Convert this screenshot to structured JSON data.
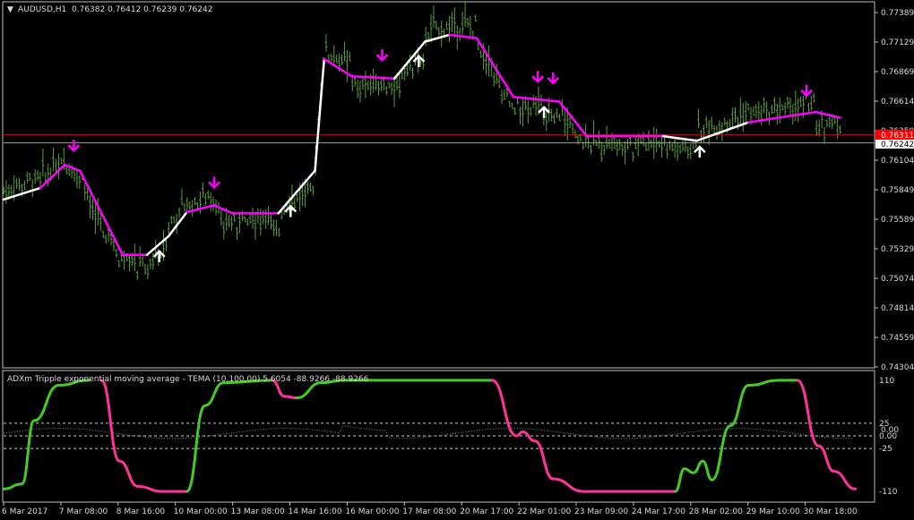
{
  "main_header": {
    "symbol": "AUDUSD,H1",
    "ohlc": "0.76382 0.76412 0.76239 0.76242"
  },
  "indicator_header": "ADXm Tripple exponential moving average - TEMA (10,100,00)  5.6054 -88.9266 -88.9266",
  "price_labels": [
    "0.77389",
    "0.77129",
    "0.76869",
    "0.76614",
    "0.76359",
    "0.76104",
    "0.75849",
    "0.75589",
    "0.75329",
    "0.75074",
    "0.74814",
    "0.74559",
    "0.74304"
  ],
  "current_price": "0.76242",
  "red_level_label": "0.76311",
  "indicator_labels": [
    "110",
    "25",
    "0.00",
    "-25",
    "-110"
  ],
  "indicator_extra_label": "0.00",
  "time_labels": [
    "6 Mar 2017",
    "7 Mar 08:00",
    "8 Mar 16:00",
    "10 Mar 00:00",
    "13 Mar 08:00",
    "14 Mar 16:00",
    "16 Mar 00:00",
    "17 Mar 08:00",
    "20 Mar 17:00",
    "22 Mar 01:00",
    "23 Mar 09:00",
    "24 Mar 17:00",
    "28 Mar 02:00",
    "29 Mar 10:00",
    "30 Mar 18:00"
  ],
  "colors": {
    "background": "#000000",
    "bars": "#5a9e3a",
    "trail_up": "#ffffff",
    "trail_down": "#ff00ff",
    "arrow_down": "#ff00ff",
    "arrow_up": "#ffffff",
    "ind_up": "#44cc22",
    "ind_down": "#ff3399",
    "red_level": "#ff0000",
    "current_line": "#a0a0a0"
  },
  "chart_data": {
    "type": "line",
    "price": {
      "ylim": [
        0.74304,
        0.77389
      ],
      "x": [
        "6 Mar 2017",
        "7 Mar 08:00",
        "8 Mar 16:00",
        "10 Mar 00:00",
        "13 Mar 08:00",
        "14 Mar 16:00",
        "16 Mar 00:00",
        "17 Mar 08:00",
        "20 Mar 17:00",
        "22 Mar 01:00",
        "23 Mar 09:00",
        "24 Mar 17:00",
        "28 Mar 02:00",
        "29 Mar 10:00",
        "30 Mar 18:00"
      ],
      "trail_points": [
        {
          "i": 0,
          "p": 0.7575,
          "trend": "up"
        },
        {
          "i": 0.6,
          "p": 0.7585,
          "trend": "up"
        },
        {
          "i": 1.0,
          "p": 0.7605,
          "trend": "down"
        },
        {
          "i": 1.25,
          "p": 0.76,
          "trend": "down"
        },
        {
          "i": 1.95,
          "p": 0.7527,
          "trend": "down"
        },
        {
          "i": 2.35,
          "p": 0.7527,
          "trend": "down"
        },
        {
          "i": 2.7,
          "p": 0.7543,
          "trend": "up"
        },
        {
          "i": 3.0,
          "p": 0.7564,
          "trend": "up"
        },
        {
          "i": 3.45,
          "p": 0.757,
          "trend": "down"
        },
        {
          "i": 3.75,
          "p": 0.7563,
          "trend": "down"
        },
        {
          "i": 4.5,
          "p": 0.7563,
          "trend": "down"
        },
        {
          "i": 5.1,
          "p": 0.76,
          "trend": "up"
        },
        {
          "i": 5.25,
          "p": 0.7697,
          "trend": "up"
        },
        {
          "i": 5.7,
          "p": 0.7682,
          "trend": "down"
        },
        {
          "i": 6.4,
          "p": 0.768,
          "trend": "down"
        },
        {
          "i": 6.9,
          "p": 0.7712,
          "trend": "up"
        },
        {
          "i": 7.3,
          "p": 0.7718,
          "trend": "up"
        },
        {
          "i": 7.75,
          "p": 0.7715,
          "trend": "down"
        },
        {
          "i": 8.35,
          "p": 0.7664,
          "trend": "down"
        },
        {
          "i": 9.1,
          "p": 0.766,
          "trend": "down"
        },
        {
          "i": 9.55,
          "p": 0.763,
          "trend": "down"
        },
        {
          "i": 10.8,
          "p": 0.763,
          "trend": "down"
        },
        {
          "i": 11.35,
          "p": 0.7626,
          "trend": "up"
        },
        {
          "i": 12.2,
          "p": 0.7642,
          "trend": "up"
        },
        {
          "i": 13.3,
          "p": 0.7651,
          "trend": "down"
        },
        {
          "i": 13.7,
          "p": 0.7646,
          "trend": "down"
        }
      ],
      "signals_down": [
        1.15,
        3.45,
        6.2,
        8.75,
        9.0,
        13.15
      ],
      "signals_up": [
        2.55,
        4.7,
        6.8,
        8.85,
        11.4
      ],
      "current_price": 0.76242,
      "red_level": 0.76311
    },
    "indicator": {
      "ylim": [
        -115,
        115
      ],
      "levels": [
        25,
        0,
        -25
      ],
      "segments": [
        {
          "color": "up",
          "points": [
            [
              0,
              -105
            ],
            [
              0.3,
              -95
            ],
            [
              0.5,
              30
            ],
            [
              0.9,
              100
            ],
            [
              1.4,
              110
            ]
          ]
        },
        {
          "color": "down",
          "points": [
            [
              1.6,
              110
            ],
            [
              1.9,
              -50
            ],
            [
              2.2,
              -100
            ],
            [
              2.6,
              -110
            ],
            [
              3.0,
              -110
            ]
          ]
        },
        {
          "color": "up",
          "points": [
            [
              3.0,
              -110
            ],
            [
              3.3,
              60
            ],
            [
              3.6,
              105
            ],
            [
              4.4,
              110
            ]
          ]
        },
        {
          "color": "down",
          "points": [
            [
              4.4,
              110
            ],
            [
              4.6,
              78
            ],
            [
              4.8,
              75
            ]
          ]
        },
        {
          "color": "up",
          "points": [
            [
              4.8,
              75
            ],
            [
              5.2,
              105
            ],
            [
              5.6,
              110
            ],
            [
              8.0,
              110
            ]
          ]
        },
        {
          "color": "down",
          "points": [
            [
              8.0,
              110
            ],
            [
              8.4,
              0
            ],
            [
              8.5,
              8
            ],
            [
              8.7,
              -10
            ],
            [
              9.0,
              -85
            ],
            [
              9.5,
              -110
            ],
            [
              11.0,
              -110
            ]
          ]
        },
        {
          "color": "up",
          "points": [
            [
              11.0,
              -110
            ],
            [
              11.15,
              -65
            ],
            [
              11.3,
              -73
            ],
            [
              11.45,
              -50
            ],
            [
              11.6,
              -87
            ],
            [
              11.9,
              20
            ],
            [
              12.2,
              100
            ],
            [
              12.7,
              110
            ],
            [
              13.0,
              110
            ]
          ]
        },
        {
          "color": "down",
          "points": [
            [
              13.0,
              110
            ],
            [
              13.35,
              -20
            ],
            [
              13.6,
              -70
            ],
            [
              13.95,
              -105
            ]
          ]
        }
      ]
    }
  }
}
